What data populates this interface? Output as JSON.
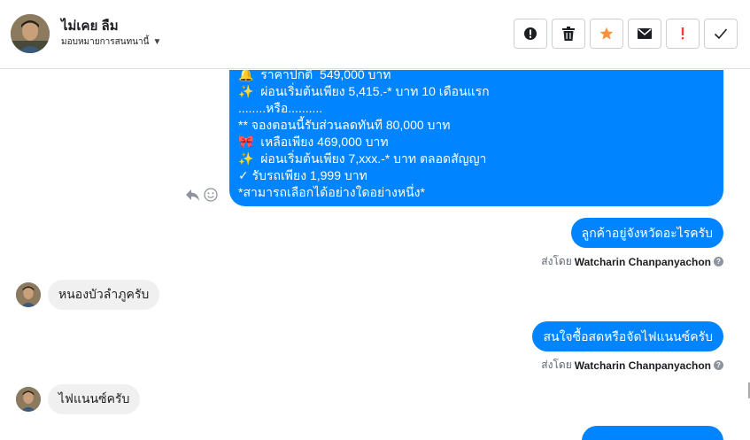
{
  "header": {
    "contact_name": "ไม่เคย ลืม",
    "assign_label": "มอบหมายการสนทนานี้",
    "toolbar": [
      {
        "name": "alert-button",
        "icon": "alert-circle-icon"
      },
      {
        "name": "delete-button",
        "icon": "trash-icon"
      },
      {
        "name": "star-button",
        "icon": "star-icon"
      },
      {
        "name": "email-button",
        "icon": "envelope-icon"
      },
      {
        "name": "spam-button",
        "icon": "exclamation-icon"
      },
      {
        "name": "done-button",
        "icon": "check-icon"
      }
    ]
  },
  "messages": {
    "big_lines": [
      "🔔  ราคาปกติ  549,000 บาท",
      "✨  ผ่อนเริ่มต้นเพียง 5,415.-* บาท 10 เดือนแรก",
      "........หรือ..........",
      "** จองตอนนี้รับส่วนลดทันที 80,000 บาท",
      "🎀  เหลือเพียง 469,000 บาท",
      "✨  ผ่อนเริ่มต้นเพียง 7,xxx.-* บาท ตลอดสัญญา",
      "✓ รับรถเพียง 1,999 บาท",
      "*สามารถเลือกได้อย่างใดอย่างหนึ่ง*"
    ],
    "out_1": "ลูกค้าอยู่จังหวัดอะไรครับ",
    "sent_by_prefix": "ส่งโดย",
    "agent_name": "Watcharin Chanpanyachon",
    "in_1": "หนองบัวลำภูครับ",
    "out_2": "สนใจซื้อสดหรือจัดไฟแนนซ์ครับ",
    "in_2": "ไฟแนนซ์ครับ"
  },
  "colors": {
    "outgoing": "#0084ff",
    "incoming": "#f1f0f0",
    "star": "#f7923b",
    "spam": "#fa383e"
  }
}
